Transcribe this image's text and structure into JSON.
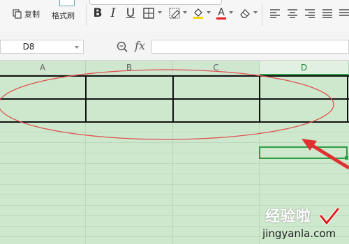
{
  "toolbar": {
    "copy_label": "复制",
    "format_painter_label": "格式刷",
    "bold_label": "B",
    "italic_label": "I",
    "underline_label": "U",
    "font_color_label": "A"
  },
  "formula_bar": {
    "name_box_value": "D8",
    "fx_label": "fx",
    "formula_value": ""
  },
  "columns": [
    {
      "label": "A",
      "selected": false
    },
    {
      "label": "B",
      "selected": false
    },
    {
      "label": "C",
      "selected": false
    },
    {
      "label": "D",
      "selected": true
    }
  ],
  "watermark": {
    "title": "经验啦",
    "url": "jingyanla.com"
  },
  "colors": {
    "sheet_background": "#cde8cd",
    "selection": "#2d9e43",
    "annotation": "#e23b3b"
  }
}
